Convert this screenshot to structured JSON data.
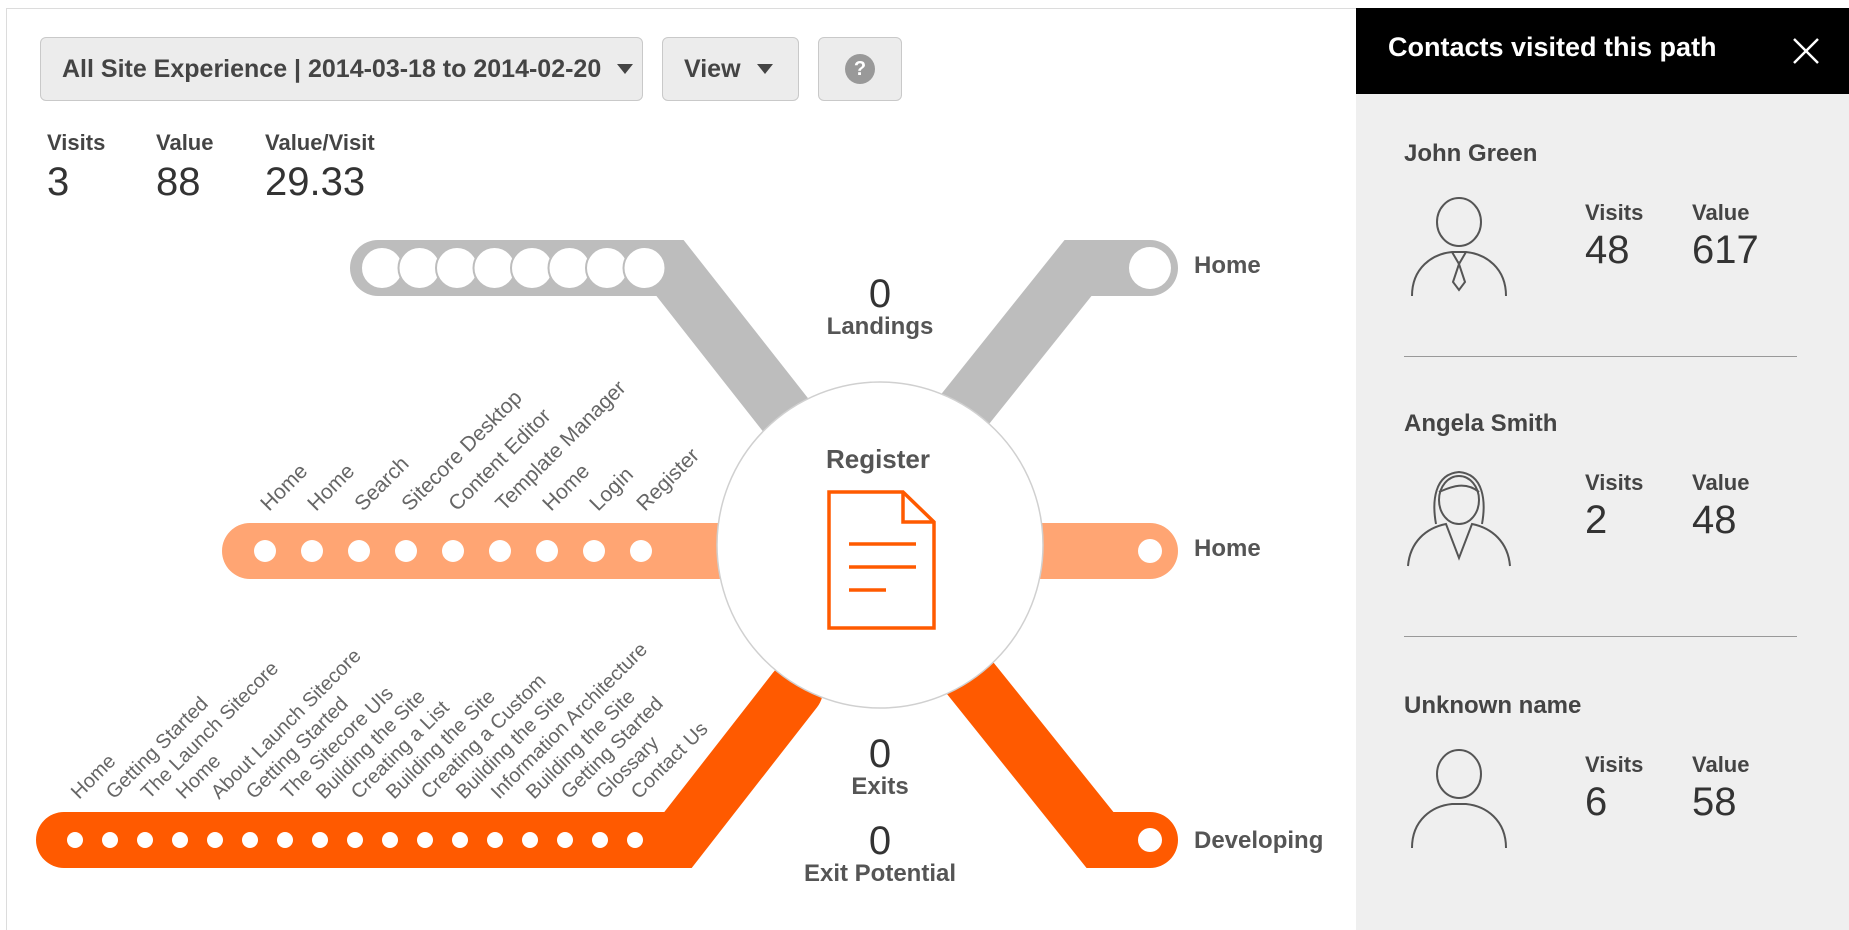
{
  "toolbar": {
    "filter_label": "All Site Experience | 2014-03-18 to 2014-02-20",
    "view_label": "View",
    "help_label": "?"
  },
  "stats": {
    "visits_label": "Visits",
    "visits_value": "3",
    "value_label": "Value",
    "value_value": "88",
    "vpv_label": "Value/Visit",
    "vpv_value": "29.33"
  },
  "diagram": {
    "center_label": "Register",
    "landings_value": "0",
    "landings_label": "Landings",
    "exits_value": "0",
    "exits_label": "Exits",
    "exit_potential_value": "0",
    "exit_potential_label": "Exit Potential",
    "right_top_label": "Home",
    "right_middle_label": "Home",
    "right_bottom_label": "Developing",
    "middle_path_pages": [
      "Home",
      "Home",
      "Search",
      "Sitecore Desktop",
      "Content Editor",
      "Template Manager",
      "Home",
      "Login",
      "Register"
    ],
    "bottom_path_pages": [
      "Home",
      "Getting Started",
      "The Launch Sitecore",
      "Home",
      "About Launch Sitecore",
      "Getting Started",
      "The Sitecore UIs",
      "Building the Site",
      "Creating a List",
      "Building the Site",
      "Creating a Custom",
      "Building the Site",
      "Information Architecture",
      "Building the Site",
      "Getting Started",
      "Glossary",
      "Contact Us"
    ],
    "colors": {
      "gray": "#bdbdbd",
      "light_orange": "#ffa573",
      "orange": "#ff5a00"
    }
  },
  "panel": {
    "title": "Contacts visited this path",
    "contacts": [
      {
        "name": "John Green",
        "visits_label": "Visits",
        "visits": "48",
        "value_label": "Value",
        "value": "617",
        "avatar": "male-suit-icon"
      },
      {
        "name": "Angela Smith",
        "visits_label": "Visits",
        "visits": "2",
        "value_label": "Value",
        "value": "48",
        "avatar": "female-icon"
      },
      {
        "name": "Unknown name",
        "visits_label": "Visits",
        "visits": "6",
        "value_label": "Value",
        "value": "58",
        "avatar": "person-icon"
      }
    ]
  }
}
